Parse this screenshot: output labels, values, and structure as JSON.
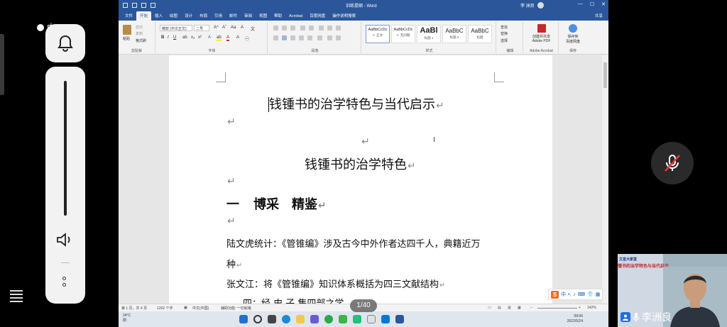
{
  "phone_overlay": {
    "left_badge": "中"
  },
  "word": {
    "title": "训练提纲 - Word",
    "user_name": "李 洲良",
    "tabs": [
      "文件",
      "开始",
      "插入",
      "绘图",
      "设计",
      "布局",
      "引用",
      "邮件",
      "审阅",
      "视图",
      "帮助",
      "Acrobat",
      "百度网盘",
      "操作说明搜索"
    ],
    "share_label": "共享",
    "ribbon": {
      "clipboard": {
        "paste": "粘贴",
        "cut": "剪切",
        "copy": "复制",
        "format_painter": "格式刷",
        "label": "剪贴板"
      },
      "font": {
        "font_name": "微软 (中文正文)",
        "font_size": "二号",
        "label": "字体"
      },
      "paragraph": {
        "label": "段落"
      },
      "styles": {
        "items": [
          {
            "sample": "AaBbCcDc",
            "name": "↵ 正文"
          },
          {
            "sample": "AaBbCcDc",
            "name": "↵ 无间隔"
          },
          {
            "sample": "AaBl",
            "name": "标题 1"
          },
          {
            "sample": "AaBbC",
            "name": "标题 2"
          },
          {
            "sample": "AaBbC",
            "name": "标题"
          }
        ],
        "label": "样式"
      },
      "editing": {
        "find": "查找",
        "replace": "替换",
        "select": "选择",
        "label": "编辑"
      },
      "acrobat": {
        "line1": "创建并共享",
        "line2": "Adobe PDF",
        "label": "Adobe Acrobat"
      },
      "save": {
        "line1": "保存到",
        "line2": "百度网盘",
        "label": "保存"
      }
    },
    "document": {
      "title": "钱锺书的治学特色与当代启示",
      "heading": "钱锺书的治学特色",
      "section_num": "一",
      "section_text": "博采　精鉴",
      "para1_line1": "陆文虎统计：《管锥编》涉及古今中外作者达四千人，典籍近万",
      "para1_line2": "种",
      "para2": "张文江：将《管锥编》知识体系概括为四三文献结构",
      "para3": "四：经 史 子 集四部之学"
    },
    "status": {
      "page": "第 1 页，共 4 页",
      "words": "1202 个字",
      "lang": "中文(中国)",
      "a11y": "辅助功能: 一切就绪",
      "zoom": "142%"
    },
    "taskbar": {
      "weather_temp": "24°C",
      "weather_text": "阴",
      "time": "09:06",
      "date": "2022/5/24"
    }
  },
  "page_indicator": "1/40",
  "ime": {
    "label": "中"
  },
  "video": {
    "slide_header": "文宣大家堂",
    "slide_title": "锺书的治学特色与当代启示",
    "speaker": "李洲良"
  },
  "colors": {
    "word_blue": "#2b579a",
    "accent_red": "#c0262d"
  }
}
